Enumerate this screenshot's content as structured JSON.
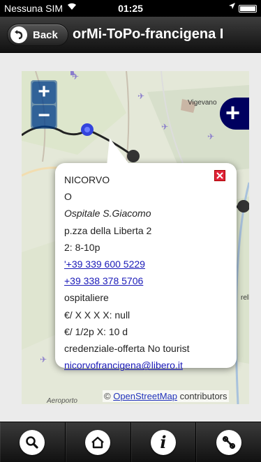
{
  "status_bar": {
    "carrier": "Nessuna SIM",
    "time": "01:25"
  },
  "header": {
    "back_label": "Back",
    "title": "orMi-ToPo-francigena I"
  },
  "map": {
    "zoom_in_label": "+",
    "zoom_out_label": "−",
    "layer_label": "+",
    "place_labels": {
      "vigevano": "Vigevano",
      "rella": "rella",
      "aero": "Aeroporto"
    },
    "attribution": {
      "prefix": "© ",
      "link": "OpenStreetMap",
      "suffix": " contributors"
    }
  },
  "popup": {
    "town": "NICORVO",
    "code": "O",
    "name": "Ospitale S.Giacomo",
    "address": "p.zza della Liberta 2",
    "hours": "2: 8-10p",
    "phone1": "'+39 339 600 5229",
    "phone2": "+39 338 378 5706",
    "host": "ospitaliere",
    "price1": "€/ X X X X: null",
    "price2": "€/ 1/2p X: 10 d",
    "note": "credenziale-offerta No tourist",
    "email": "nicorvofrancigena@libero.it"
  },
  "tab_bar": {
    "icons": [
      "search-icon",
      "home-icon",
      "info-icon",
      "wrench-icon"
    ]
  },
  "colors": {
    "map_control_blue": "#003c88",
    "layer_button": "#00005f",
    "link": "#1a1ab8",
    "close_red": "#e0243a"
  }
}
